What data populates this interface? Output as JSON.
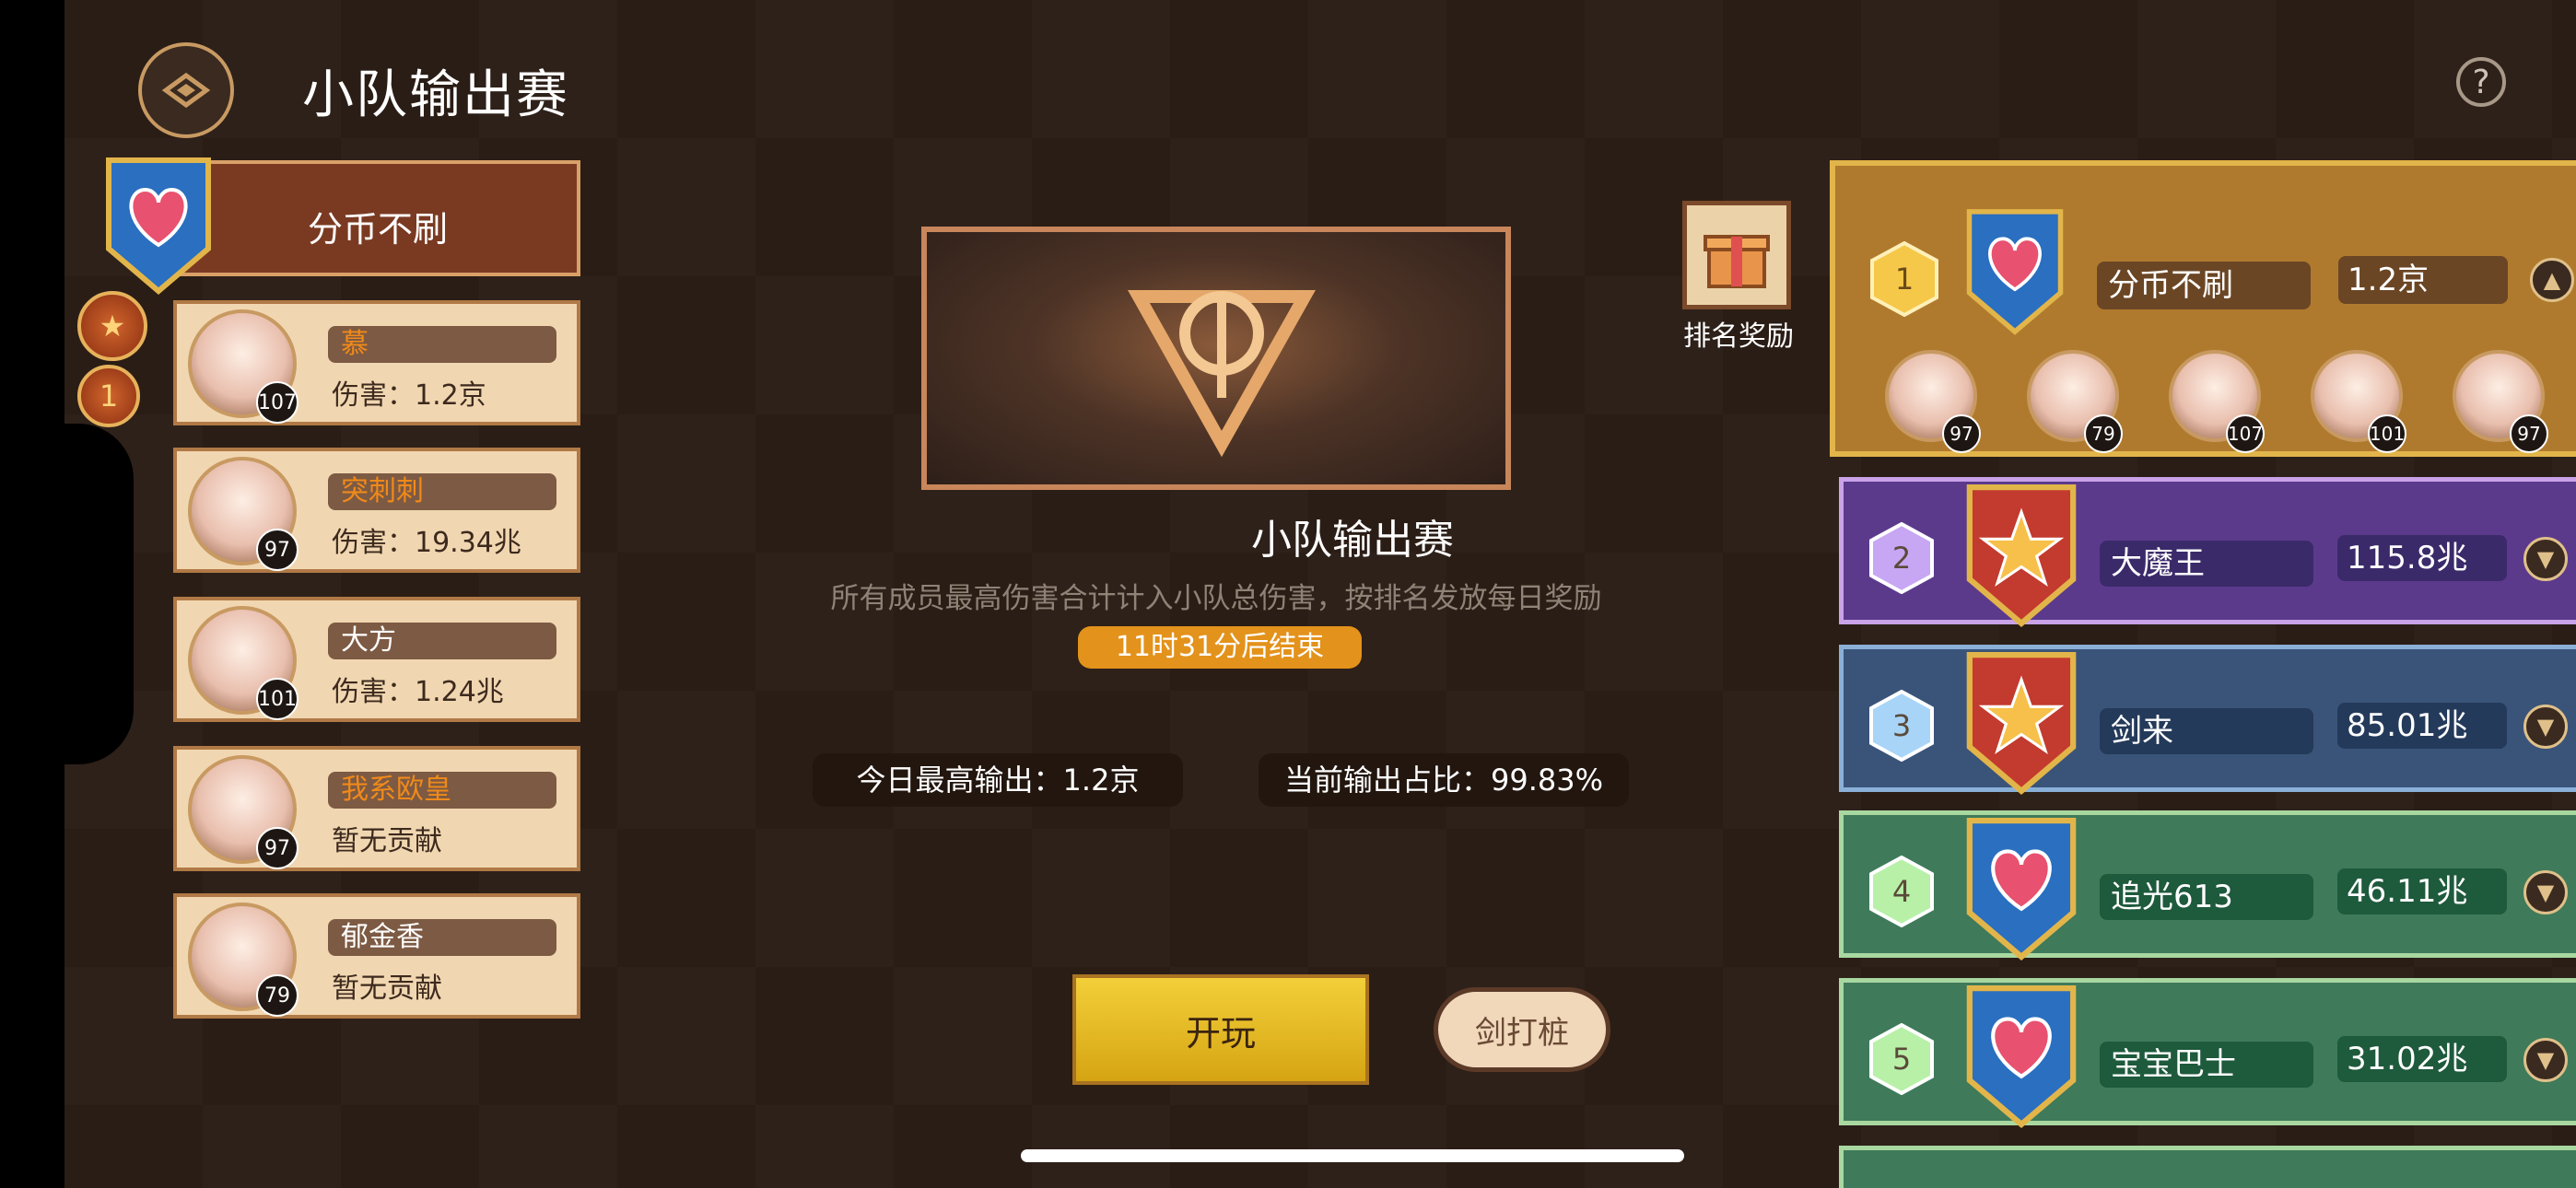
{
  "header": {
    "title": "小队输出赛",
    "help_label": "?"
  },
  "my_team": {
    "name": "分币不刷",
    "members": [
      {
        "name": "慕",
        "damage": "伤害：1.2京",
        "level": "107",
        "name_color": "#f08a1a"
      },
      {
        "name": "突刺刺",
        "damage": "伤害：19.34兆",
        "level": "97",
        "name_color": "#f08a1a"
      },
      {
        "name": "大方",
        "damage": "伤害：1.24兆",
        "level": "101",
        "name_color": "#ffffff"
      },
      {
        "name": "我系欧皇",
        "damage": "暂无贡献",
        "level": "97",
        "name_color": "#f08a1a"
      },
      {
        "name": "郁金香",
        "damage": "暂无贡献",
        "level": "79",
        "name_color": "#ffffff"
      }
    ],
    "badge_rank": "1"
  },
  "event": {
    "title": "小队输出赛",
    "description": "所有成员最高伤害合计计入小队总伤害，按排名发放每日奖励",
    "timer": "11时31分后结束",
    "today_max": "今日最高输出：1.2京",
    "share": "当前输出占比：99.83%",
    "play_label": "开玩",
    "dummy_label": "剑打桩",
    "reward_label": "排名奖励"
  },
  "ranking": [
    {
      "rank": "1",
      "name": "分币不刷",
      "damage": "1.2京",
      "member_levels": [
        "97",
        "79",
        "107",
        "101",
        "97"
      ]
    },
    {
      "rank": "2",
      "name": "大魔王",
      "damage": "115.8兆"
    },
    {
      "rank": "3",
      "name": "剑来",
      "damage": "85.01兆"
    },
    {
      "rank": "4",
      "name": "追光613",
      "damage": "46.11兆"
    },
    {
      "rank": "5",
      "name": "宝宝巴士",
      "damage": "31.02兆"
    }
  ],
  "colors": {
    "gold": "#e2b54a",
    "purple": "#5b3a8c",
    "blue": "#3a5479",
    "green": "#3f7a5a",
    "orange": "#e3921b"
  }
}
